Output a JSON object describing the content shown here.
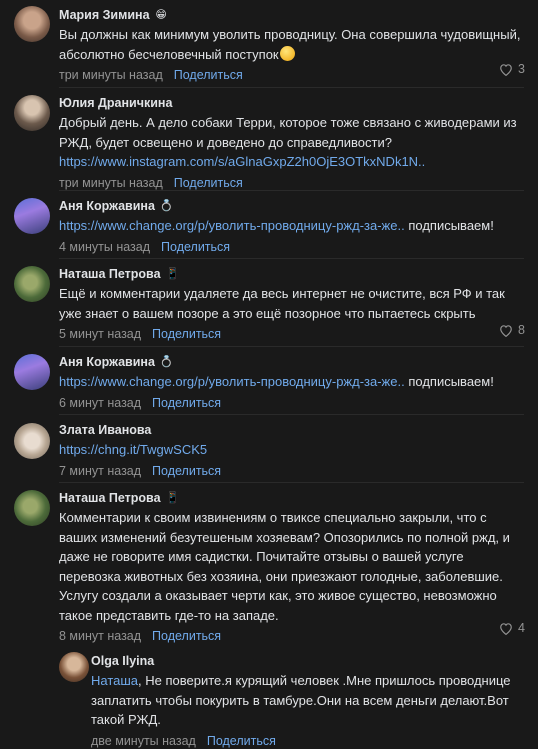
{
  "reply_label": "Поделиться",
  "comments": [
    {
      "author": "Мария Зимина",
      "badge": "😁",
      "text": "Вы должны как минимум уволить проводницу. Она совершила чудовищный, абсолютно бесчеловечный поступок",
      "text_emoji": "😩",
      "time": "три минуты назад",
      "likes": "3"
    },
    {
      "author": "Юлия Драничкина",
      "text": "Добрый день. А дело собаки Терри, которое тоже связано с живодерами из РЖД, будет освещено и доведено до справедливости?",
      "link": "https://www.instagram.com/s/aGlnaGxpZ2h0OjE3OTkxNDk1N..",
      "time": "три минуты назад"
    },
    {
      "author": "Аня Коржавина",
      "badge": "💍",
      "link": "https://www.change.org/p/уволить-проводницу-ржд-за-же..",
      "text_after": "подписываем!",
      "time": "4 минуты назад"
    },
    {
      "author": "Наташа Петрова",
      "badge": "📱",
      "text": "Ещё и комментарии удаляете да весь интернет не очистите, вся РФ и так уже знает о вашем позоре а это ещё позорное что пытаетесь скрыть",
      "time": "5 минут назад",
      "likes": "8"
    },
    {
      "author": "Аня Коржавина",
      "badge": "💍",
      "link": "https://www.change.org/p/уволить-проводницу-ржд-за-же..",
      "text_after": "подписываем!",
      "time": "6 минут назад"
    },
    {
      "author": "Злата Иванова",
      "link": "https://chng.it/TwgwSCK5",
      "time": "7 минут назад"
    },
    {
      "author": "Наташа Петрова",
      "badge": "📱",
      "text": "Комментарии к своим извинениям о твиксе специально закрыли, что с ваших изменений безутешеным хозяевам? Опозорились по полной ржд, и даже не говорите имя садистки. Почитайте отзывы о вашей услуге перевозка животных без хозяина, они приезжают голодные, заболевшие. Услугу создали а оказывает черти как, это живое существо, невозможно такое представить где-то на западе.",
      "time": "8 минут назад",
      "likes": "4"
    },
    {
      "author": "Olga Ilyina",
      "mention": "Наташа",
      "text": ", Не поверите.я курящий человек .Мне пришлось проводнице заплатить чтобы покурить в тамбуре.Они на всем деньги делают.Вот такой РЖД.",
      "time": "две минуты назад"
    }
  ],
  "colors": {
    "background": "#191919",
    "text": "#e1e3e6",
    "secondary": "#939393",
    "link": "#71aaeb"
  }
}
